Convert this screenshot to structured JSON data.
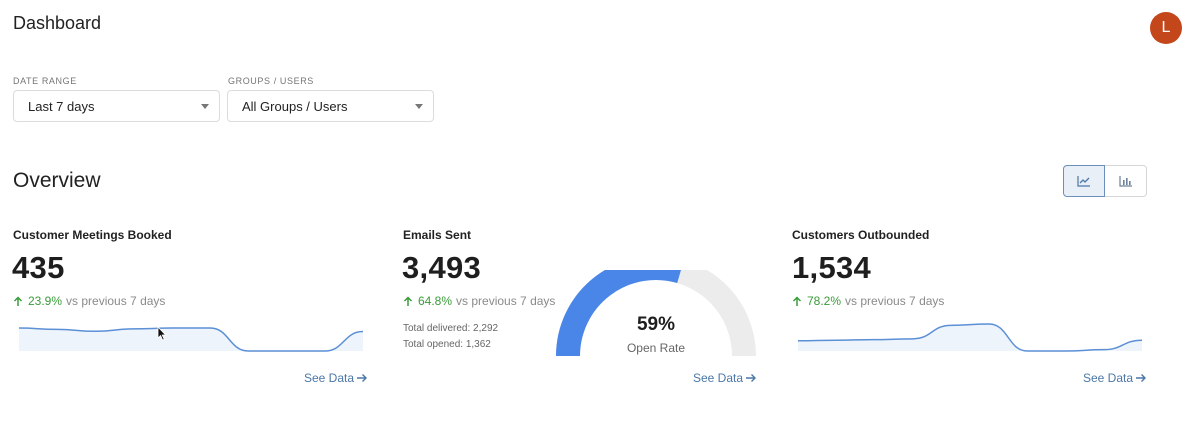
{
  "header": {
    "title": "Dashboard",
    "avatar_initial": "L"
  },
  "filters": {
    "date_range": {
      "label": "DATE RANGE",
      "value": "Last 7 days"
    },
    "groups_users": {
      "label": "GROUPS / USERS",
      "value": "All Groups / Users"
    }
  },
  "overview": {
    "title": "Overview",
    "view_toggle": {
      "selected": "line-chart",
      "options": [
        "line-chart-icon",
        "bar-chart-icon"
      ]
    }
  },
  "cards": [
    {
      "title": "Customer Meetings Booked",
      "value": "435",
      "delta_pct": "23.9%",
      "delta_text": "vs previous 7 days",
      "link": "See Data",
      "trend": [
        0.85,
        0.8,
        0.73,
        0.82,
        0.85,
        0.85,
        0.0,
        0.0,
        0.0,
        0.72
      ]
    },
    {
      "title": "Emails Sent",
      "value": "3,493",
      "delta_pct": "64.8%",
      "delta_text": "vs previous 7 days",
      "total_delivered": "Total delivered: 2,292",
      "total_opened": "Total opened: 1,362",
      "gauge_value": "59%",
      "gauge_fraction": 0.59,
      "gauge_label": "Open Rate",
      "link": "See Data"
    },
    {
      "title": "Customers Outbounded",
      "value": "1,534",
      "delta_pct": "78.2%",
      "delta_text": "vs previous 7 days",
      "link": "See Data",
      "trend": [
        0.38,
        0.4,
        0.42,
        0.45,
        0.95,
        1.0,
        0.0,
        0.0,
        0.05,
        0.4
      ]
    }
  ],
  "colors": {
    "accent": "#4a86e8",
    "positive": "#3a9c3a",
    "link": "#4b77a7",
    "avatar": "#c4471b",
    "gauge_track": "#ececec"
  }
}
